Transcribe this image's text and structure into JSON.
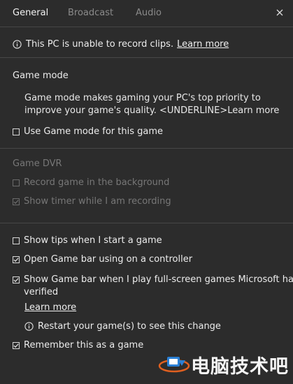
{
  "tabs": [
    {
      "label": "General",
      "active": true
    },
    {
      "label": "Broadcast",
      "active": false
    },
    {
      "label": "Audio",
      "active": false
    }
  ],
  "notice": {
    "text": "This PC is unable to record clips.",
    "link": "Learn more"
  },
  "game_mode": {
    "title": "Game mode",
    "description_line1": "Game mode makes gaming your PC's top priority to",
    "description_line2": "improve your game's quality. <UNDERLINE>Learn more",
    "checkbox_label": "Use Game mode for this game",
    "checked": false
  },
  "game_dvr": {
    "title": "Game DVR",
    "record_bg_label": "Record game in the background",
    "record_bg_checked": false,
    "timer_label": "Show timer while I am recording",
    "timer_checked": true
  },
  "options": {
    "tips_label": "Show tips when I start a game",
    "tips_checked": false,
    "controller_label": "Open Game bar using  on a controller",
    "controller_checked": true,
    "fullscreen_line1": "Show Game bar when I play full-screen games Microsoft has",
    "fullscreen_line2": "verified",
    "fullscreen_checked": true,
    "learn_more": "Learn more",
    "restart_note": "Restart your game(s) to see this change",
    "remember_label": "Remember this as a game",
    "remember_checked": true
  },
  "watermark": {
    "text": "电脑技术吧"
  },
  "colors": {
    "background": "#2c2c2c",
    "divider": "#474747",
    "disabled_text": "#777777"
  }
}
